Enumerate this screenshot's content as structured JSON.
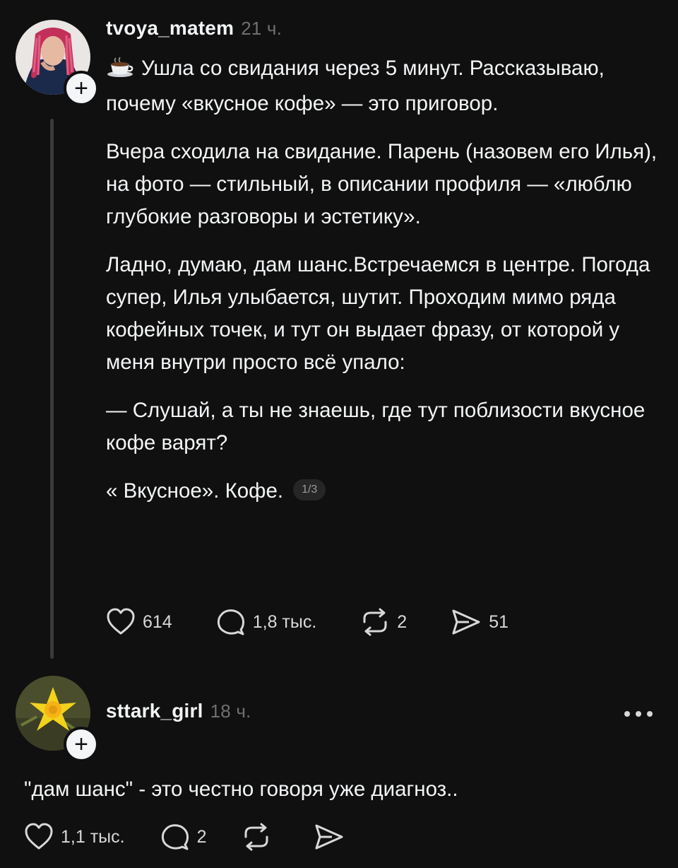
{
  "post": {
    "username": "tvoya_matem",
    "time": "21 ч.",
    "emoji": "coffee-cup-icon",
    "lines": {
      "p1": "Ушла со свидания через 5 минут. Рассказываю, почему «вкусное кофе» — это приговор.",
      "p2": "Вчера сходила на свидание. Парень (назовем его Илья), на фото — стильный, в описании профиля — «люблю глубокие разговоры и эстетику».",
      "p3": "Ладно, думаю, дам шанс.Встречаемся в центре. Погода супер, Илья улыбается, шутит. Проходим мимо ряда кофейных точек, и тут он выдает фразу, от которой у меня внутри просто всё упало:",
      "p4": "— Слушай, а ты не знаешь, где тут поблизости вкусное кофе варят?",
      "p5": "« Вкусное». Кофе."
    },
    "page_indicator": "1/3",
    "stats": {
      "likes": "614",
      "comments": "1,8 тыс.",
      "reposts": "2",
      "shares": "51"
    }
  },
  "reply": {
    "username": "sttark_girl",
    "time": "18 ч.",
    "text": "\"дам шанс\" - это честно говоря уже диагноз..",
    "stats": {
      "likes": "1,1 тыс.",
      "comments": "2"
    }
  },
  "follow_badge": "+"
}
